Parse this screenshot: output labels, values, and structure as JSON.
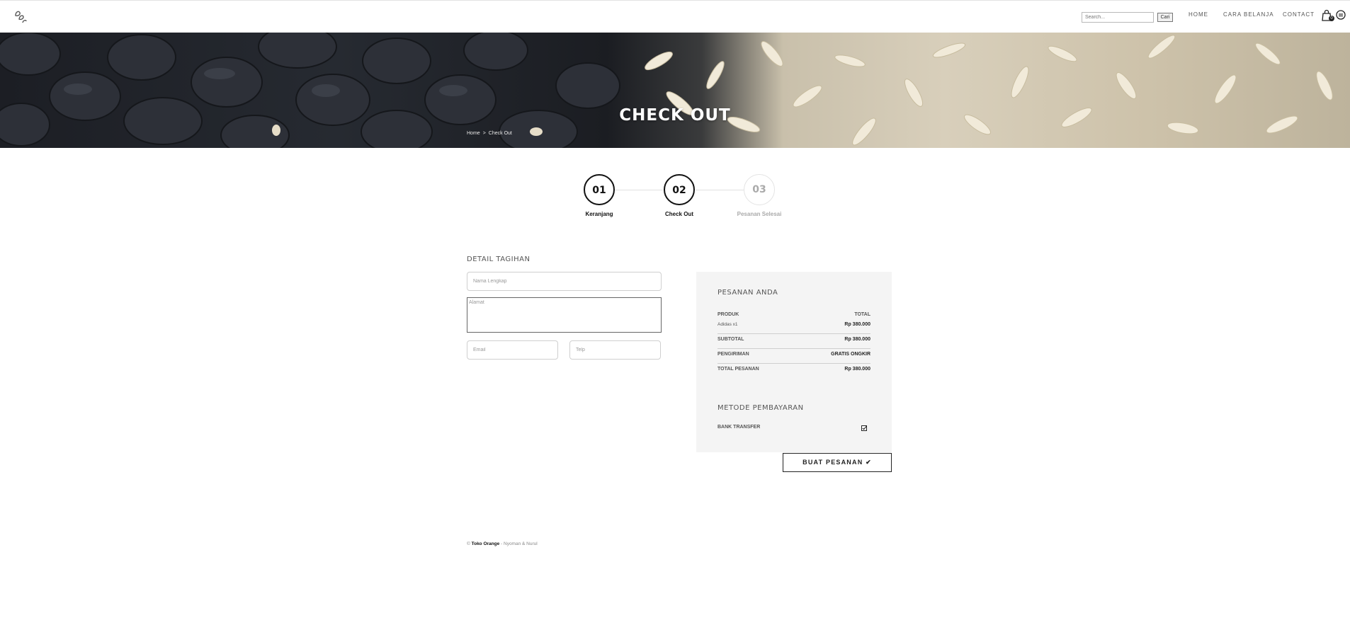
{
  "header": {
    "search_placeholder": "Search...",
    "search_button": "Cari",
    "nav": [
      "HOME",
      "CARA BELANJA",
      "CONTACT"
    ],
    "cart_count": "0"
  },
  "hero": {
    "title": "CHECK OUT",
    "breadcrumb": [
      "Home",
      ">",
      "Check Out"
    ]
  },
  "steps": [
    {
      "number": "01",
      "label": "Keranjang"
    },
    {
      "number": "02",
      "label": "Check Out"
    },
    {
      "number": "03",
      "label": "Pesanan Selesai"
    }
  ],
  "billing": {
    "title": "DETAIL TAGIHAN",
    "name_placeholder": "Nama Lengkap",
    "address_placeholder": "Alamat",
    "email_placeholder": "Email",
    "phone_placeholder": "Telp"
  },
  "order": {
    "title": "PESANAN ANDA",
    "col_product": "PRODUK",
    "col_total": "TOTAL",
    "item_name": "Adidas x1",
    "item_price": "Rp 380.000",
    "subtotal_label": "SUBTOTAL",
    "subtotal_value": "Rp 380.000",
    "shipping_label": "PENGIRIMAN",
    "shipping_value": "GRATIS ONGKIR",
    "total_label": "TOTAL PESANAN",
    "total_value": "Rp 380.000",
    "payment_title": "METODE PEMBAYARAN",
    "payment_method": "BANK TRANSFER",
    "submit_label": "BUAT PESANAN ✔"
  },
  "footer": {
    "copyright": "©",
    "brand": "Toko Orange",
    "separator": " - ",
    "authors": "Nyoman & Nurul"
  }
}
